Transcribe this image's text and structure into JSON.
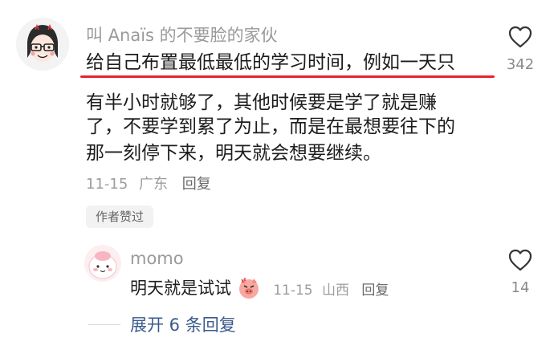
{
  "comment": {
    "username": "叫 Anaïs 的不要脸的家伙",
    "lines": [
      "给自己布置最低最低的学习时间，例如一天只",
      "有半小时就够了，其他时候要是学了就是赚",
      "了，不要学到累了为止，而是在最想要往下的",
      "那一刻停下来，明天就会想要继续。"
    ],
    "date": "11-15",
    "location": "广东",
    "reply_label": "回复",
    "author_badge": "作者赞过",
    "like_count": "342"
  },
  "reply": {
    "username": "momo",
    "text": "明天就是试试",
    "emoji": "pig-face-emoji",
    "date": "11-15",
    "location": "山西",
    "reply_label": "回复",
    "like_count": "14"
  },
  "expand_label": "展开 6 条回复",
  "colors": {
    "highlight_underline": "#e8232f",
    "muted_text": "#9c9c9c",
    "link_blue": "#3a5a8c"
  }
}
